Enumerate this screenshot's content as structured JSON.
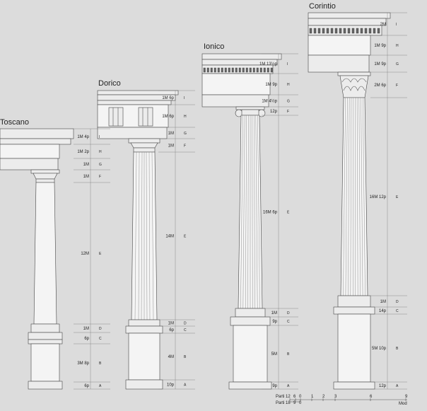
{
  "orders": [
    {
      "name": "Toscano",
      "labels": [
        "1M 4p",
        "1M 2p",
        "1M",
        "1M",
        "12M",
        "1M",
        "6p",
        "3M 8p",
        "6p"
      ],
      "letters": [
        "I",
        "H",
        "G",
        "F",
        "E",
        "D",
        "C",
        "B",
        "A"
      ]
    },
    {
      "name": "Dorico",
      "labels": [
        "1M 6p",
        "1M 6p",
        "1M",
        "1M",
        "14M",
        "1M",
        "6p",
        "4M",
        "10p"
      ],
      "letters": [
        "I",
        "H",
        "G",
        "F",
        "E",
        "D",
        "C",
        "B",
        "A"
      ]
    },
    {
      "name": "Ionico",
      "labels": [
        "1M 13½p",
        "1M 9p",
        "1M 4½p",
        "12p",
        "16M 6p",
        "1M",
        "9p",
        "5M",
        "9p"
      ],
      "letters": [
        "I",
        "H",
        "G",
        "F",
        "E",
        "D",
        "C",
        "B",
        "A"
      ]
    },
    {
      "name": "Corintio",
      "labels": [
        "2M",
        "1M 9p",
        "1M 9p",
        "2M 6p",
        "16M 12p",
        "1M",
        "14p",
        "5M 10p",
        "12p"
      ],
      "letters": [
        "I",
        "H",
        "G",
        "F",
        "E",
        "D",
        "C",
        "B",
        "A"
      ]
    }
  ],
  "scale": {
    "parti12_label": "Parti",
    "parti12_num": "12",
    "parti18_label": "Parti",
    "parti18_num": "18",
    "parti12_ticks": [
      "6",
      "0"
    ],
    "parti18_ticks": [
      "9",
      "0"
    ],
    "mod_ticks": [
      "1",
      "2",
      "3",
      "6",
      "9"
    ],
    "mod_label": "Mod"
  }
}
